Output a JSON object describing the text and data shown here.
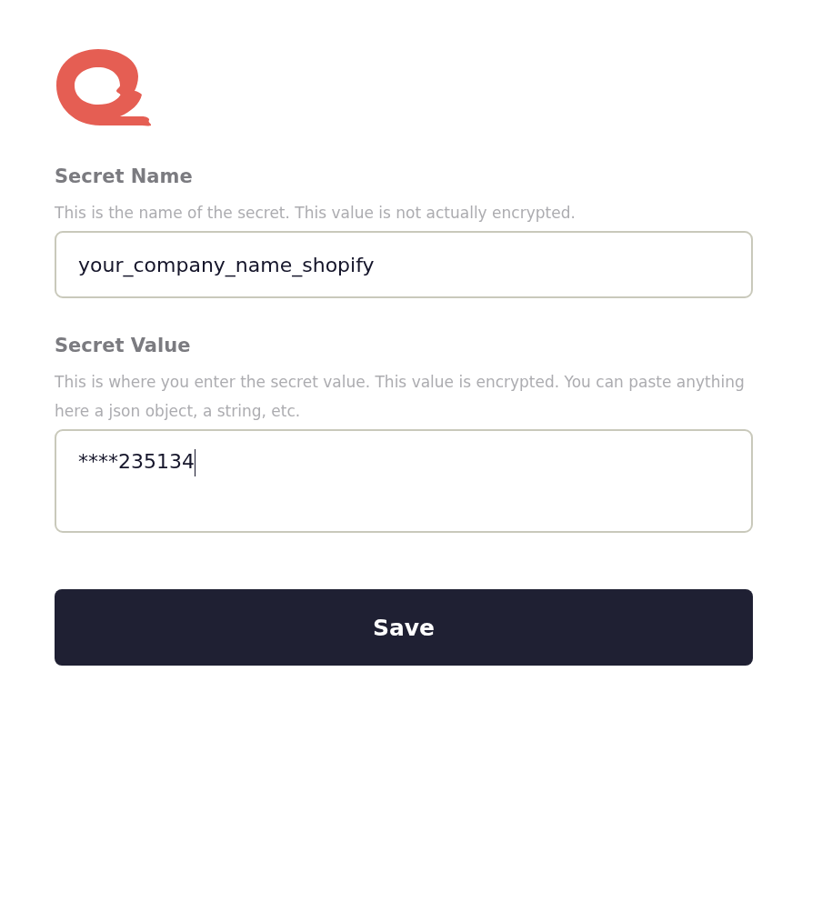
{
  "form": {
    "fields": [
      {
        "label": "Secret Name",
        "hint": "This is the name of the secret. This value is not actually encrypted.",
        "kind": "input",
        "value": "your_company_name_shopify",
        "focused": false
      },
      {
        "label": "Secret Value",
        "hint": "This is where you enter the secret value. This value is encrypted. You can paste anything here a json object, a string, etc.",
        "kind": "textarea",
        "value": "****235134",
        "focused": true
      }
    ],
    "submit": "Save"
  }
}
